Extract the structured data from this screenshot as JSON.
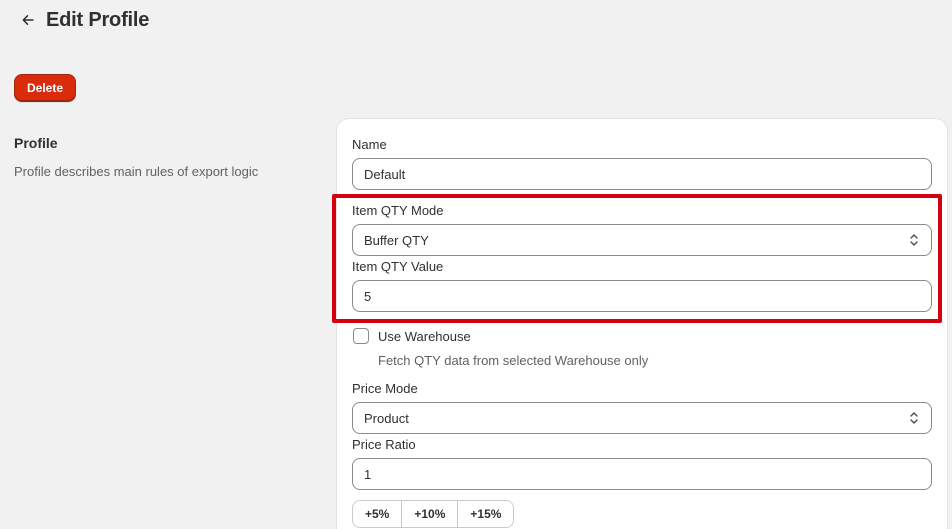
{
  "header": {
    "title": "Edit Profile"
  },
  "actions": {
    "delete_label": "Delete"
  },
  "section": {
    "heading": "Profile",
    "description": "Profile describes main rules of export logic"
  },
  "form": {
    "name": {
      "label": "Name",
      "value": "Default"
    },
    "item_qty_mode": {
      "label": "Item QTY Mode",
      "value": "Buffer QTY"
    },
    "item_qty_value": {
      "label": "Item QTY Value",
      "value": "5"
    },
    "use_warehouse": {
      "label": "Use Warehouse",
      "help": "Fetch QTY data from selected Warehouse only",
      "checked": false
    },
    "price_mode": {
      "label": "Price Mode",
      "value": "Product"
    },
    "price_ratio": {
      "label": "Price Ratio",
      "value": "1"
    },
    "ratio_buttons": [
      "+5%",
      "+10%",
      "+15%"
    ]
  },
  "colors": {
    "danger": "#d82c0d",
    "highlight": "#d4000e",
    "background": "#f1f1f1"
  },
  "icons": {
    "back": "arrow-left-icon",
    "select": "chevron-up-down-icon"
  }
}
